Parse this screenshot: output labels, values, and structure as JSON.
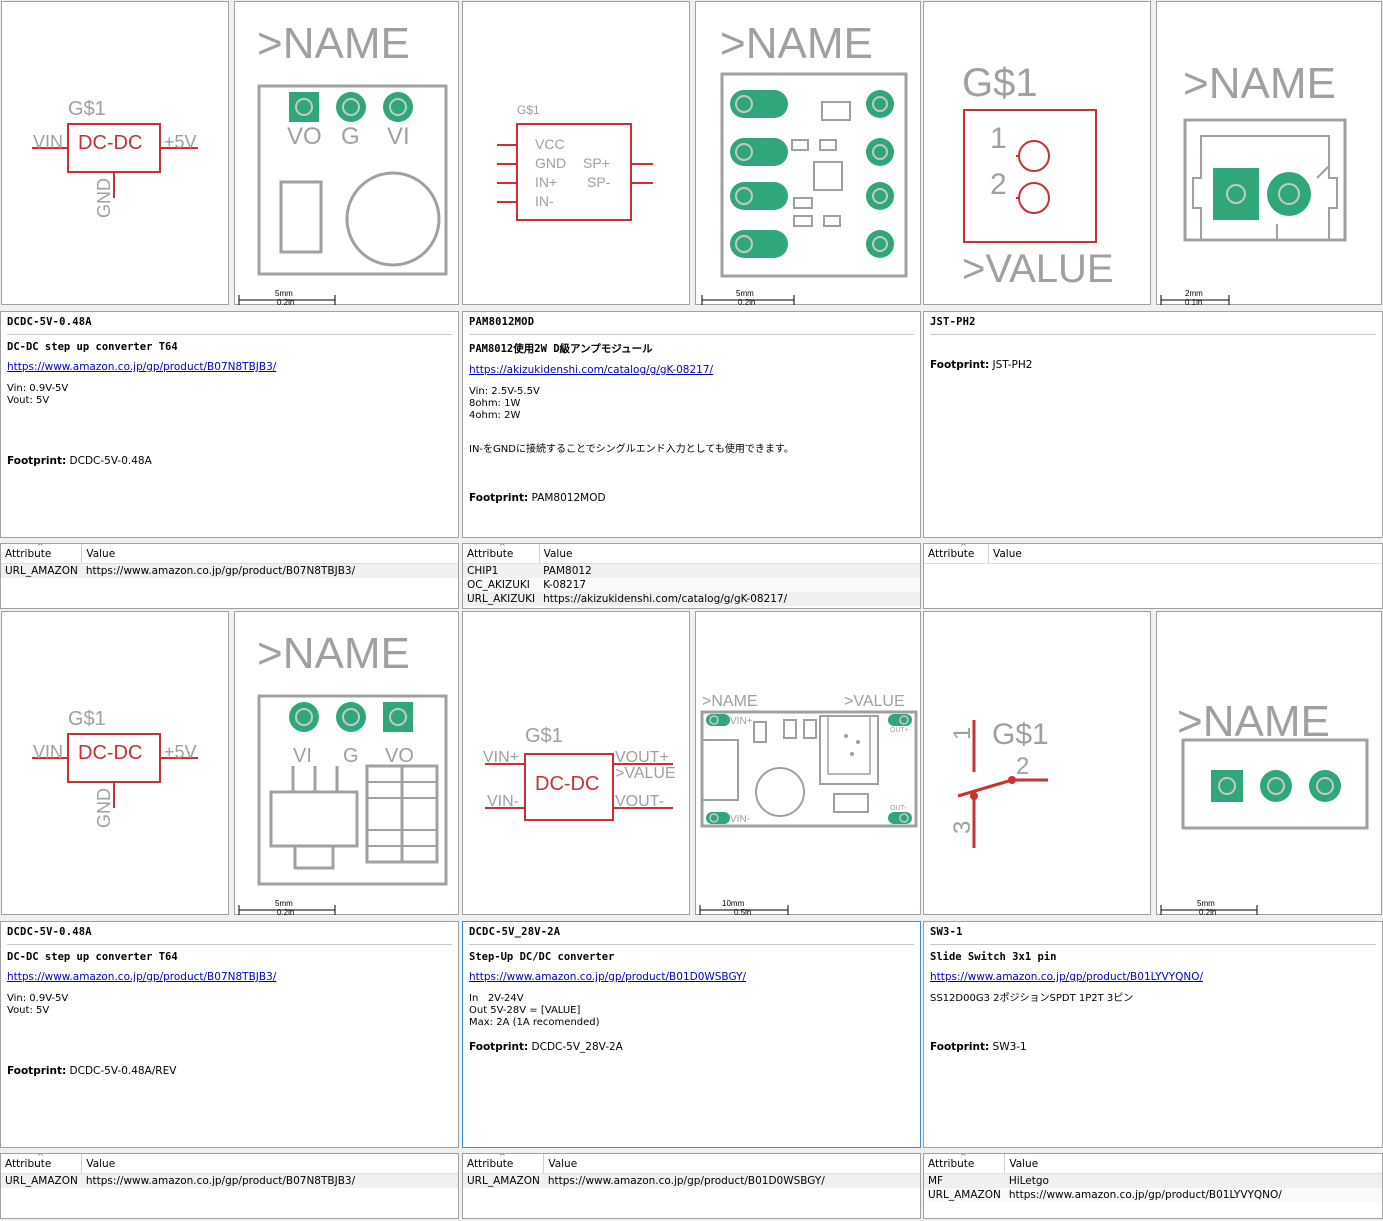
{
  "cards": [
    {
      "id": "dcdc-5v-048a-top",
      "title": "DCDC-5V-0.48A",
      "heading": "DC-DC step up converter T64",
      "url": "https://www.amazon.co.jp/gp/product/B07N8TBJB3/",
      "lines": [
        "Vin: 0.9V-5V",
        "Vout: 5V"
      ],
      "note": "",
      "footprint_label": "Footprint:",
      "footprint": "DCDC-5V-0.48A",
      "attr_header": [
        "Attribute",
        "Value"
      ],
      "attributes": [
        [
          "URL_AMAZON",
          "https://www.amazon.co.jp/gp/product/B07N8TBJB3/"
        ]
      ],
      "schematic": {
        "name": "G$1",
        "body": "DC-DC",
        "pin_left": "VIN",
        "pin_right": "+5V",
        "pin_bottom": "GND"
      },
      "package": {
        "name": ">NAME",
        "pads": [
          "VO",
          "G",
          "VI"
        ],
        "scale_mm": "5mm",
        "scale_in": "0.2in"
      }
    },
    {
      "id": "pam8012mod",
      "title": "PAM8012MOD",
      "heading": "PAM8012使用2W D級アンプモジュール",
      "url": "https://akizukidenshi.com/catalog/g/gK-08217/",
      "lines": [
        "Vin: 2.5V-5.5V",
        "8ohm: 1W",
        "4ohm: 2W"
      ],
      "note": "IN-をGNDに接続することでシングルエンド入力としても使用できます。",
      "footprint_label": "Footprint:",
      "footprint": "PAM8012MOD",
      "attr_header": [
        "Attribute",
        "Value"
      ],
      "attributes": [
        [
          "CHIP1",
          "PAM8012"
        ],
        [
          "OC_AKIZUKI",
          "K-08217"
        ],
        [
          "URL_AKIZUKI",
          "https://akizukidenshi.com/catalog/g/gK-08217/"
        ]
      ],
      "schematic": {
        "name": "G$1",
        "pins_left": [
          "VCC",
          "GND",
          "IN+",
          "IN-"
        ],
        "pins_right": [
          "SP+",
          "SP-"
        ]
      },
      "package": {
        "name": ">NAME",
        "scale_mm": "5mm",
        "scale_in": "0.2in"
      }
    },
    {
      "id": "jst-ph2",
      "title": "JST-PH2",
      "heading": "",
      "url": "",
      "lines": [],
      "note": "",
      "footprint_label": "Footprint:",
      "footprint": "JST-PH2",
      "attr_header": [
        "Attribute",
        "Value"
      ],
      "attributes": [],
      "schematic": {
        "name": "G$1",
        "value": ">VALUE",
        "pin1": "1",
        "pin2": "2"
      },
      "package": {
        "name": ">NAME",
        "scale_mm": "2mm",
        "scale_in": "0.1in"
      }
    },
    {
      "id": "dcdc-5v-048a-rev",
      "title": "DCDC-5V-0.48A",
      "heading": "DC-DC step up converter T64",
      "url": "https://www.amazon.co.jp/gp/product/B07N8TBJB3/",
      "lines": [
        "Vin: 0.9V-5V",
        "Vout: 5V"
      ],
      "note": "",
      "footprint_label": "Footprint:",
      "footprint": "DCDC-5V-0.48A/REV",
      "attr_header": [
        "Attribute",
        "Value"
      ],
      "attributes": [
        [
          "URL_AMAZON",
          "https://www.amazon.co.jp/gp/product/B07N8TBJB3/"
        ]
      ],
      "schematic": {
        "name": "G$1",
        "body": "DC-DC",
        "pin_left": "VIN",
        "pin_right": "+5V",
        "pin_bottom": "GND"
      },
      "package": {
        "name": ">NAME",
        "pads": [
          "VI",
          "G",
          "VO"
        ],
        "scale_mm": "5mm",
        "scale_in": "0.2in"
      }
    },
    {
      "id": "dcdc-5v-28v-2a",
      "title": "DCDC-5V_28V-2A",
      "heading": "Step-Up DC/DC converter",
      "url": "https://www.amazon.co.jp/gp/product/B01D0WSBGY/",
      "lines": [
        "In   2V-24V",
        "Out 5V-28V = [VALUE]",
        "Max: 2A (1A recomended)"
      ],
      "note": "",
      "footprint_label": "Footprint:",
      "footprint": "DCDC-5V_28V-2A",
      "attr_header": [
        "Attribute",
        "Value"
      ],
      "attributes": [
        [
          "URL_AMAZON",
          "https://www.amazon.co.jp/gp/product/B01D0WSBGY/"
        ]
      ],
      "schematic": {
        "name": "G$1",
        "body": "DC-DC",
        "pins_left": [
          "VIN+",
          "VIN-"
        ],
        "pins_right": [
          "VOUT+",
          ">VALUE",
          "VOUT-"
        ]
      },
      "package": {
        "name": ">NAME",
        "value": ">VALUE",
        "pads": [
          "VIN+",
          "VIN-",
          "OUT+",
          "OUT-"
        ],
        "scale_mm": "10mm",
        "scale_in": "0.5in"
      }
    },
    {
      "id": "sw3-1",
      "title": "SW3-1",
      "heading": "Slide Switch 3x1 pin",
      "url": "https://www.amazon.co.jp/gp/product/B01LYVYQNO/",
      "lines": [
        "SS12D00G3 2ポジションSPDT 1P2T 3ピン"
      ],
      "note": "",
      "footprint_label": "Footprint:",
      "footprint": "SW3-1",
      "attr_header": [
        "Attribute",
        "Value"
      ],
      "attributes": [
        [
          "MF",
          "HiLetgo"
        ],
        [
          "URL_AMAZON",
          "https://www.amazon.co.jp/gp/product/B01LYVYQNO/"
        ]
      ],
      "schematic": {
        "name": "G$1",
        "pin1": "1",
        "pin2": "2",
        "pin3": "3"
      },
      "package": {
        "name": ">NAME",
        "scale_mm": "5mm",
        "scale_in": "0.2in"
      }
    }
  ],
  "colors": {
    "schematic": "#c83232",
    "package": "#a0a0a0",
    "pad": "#2fa77a",
    "link": "#0000cc"
  }
}
